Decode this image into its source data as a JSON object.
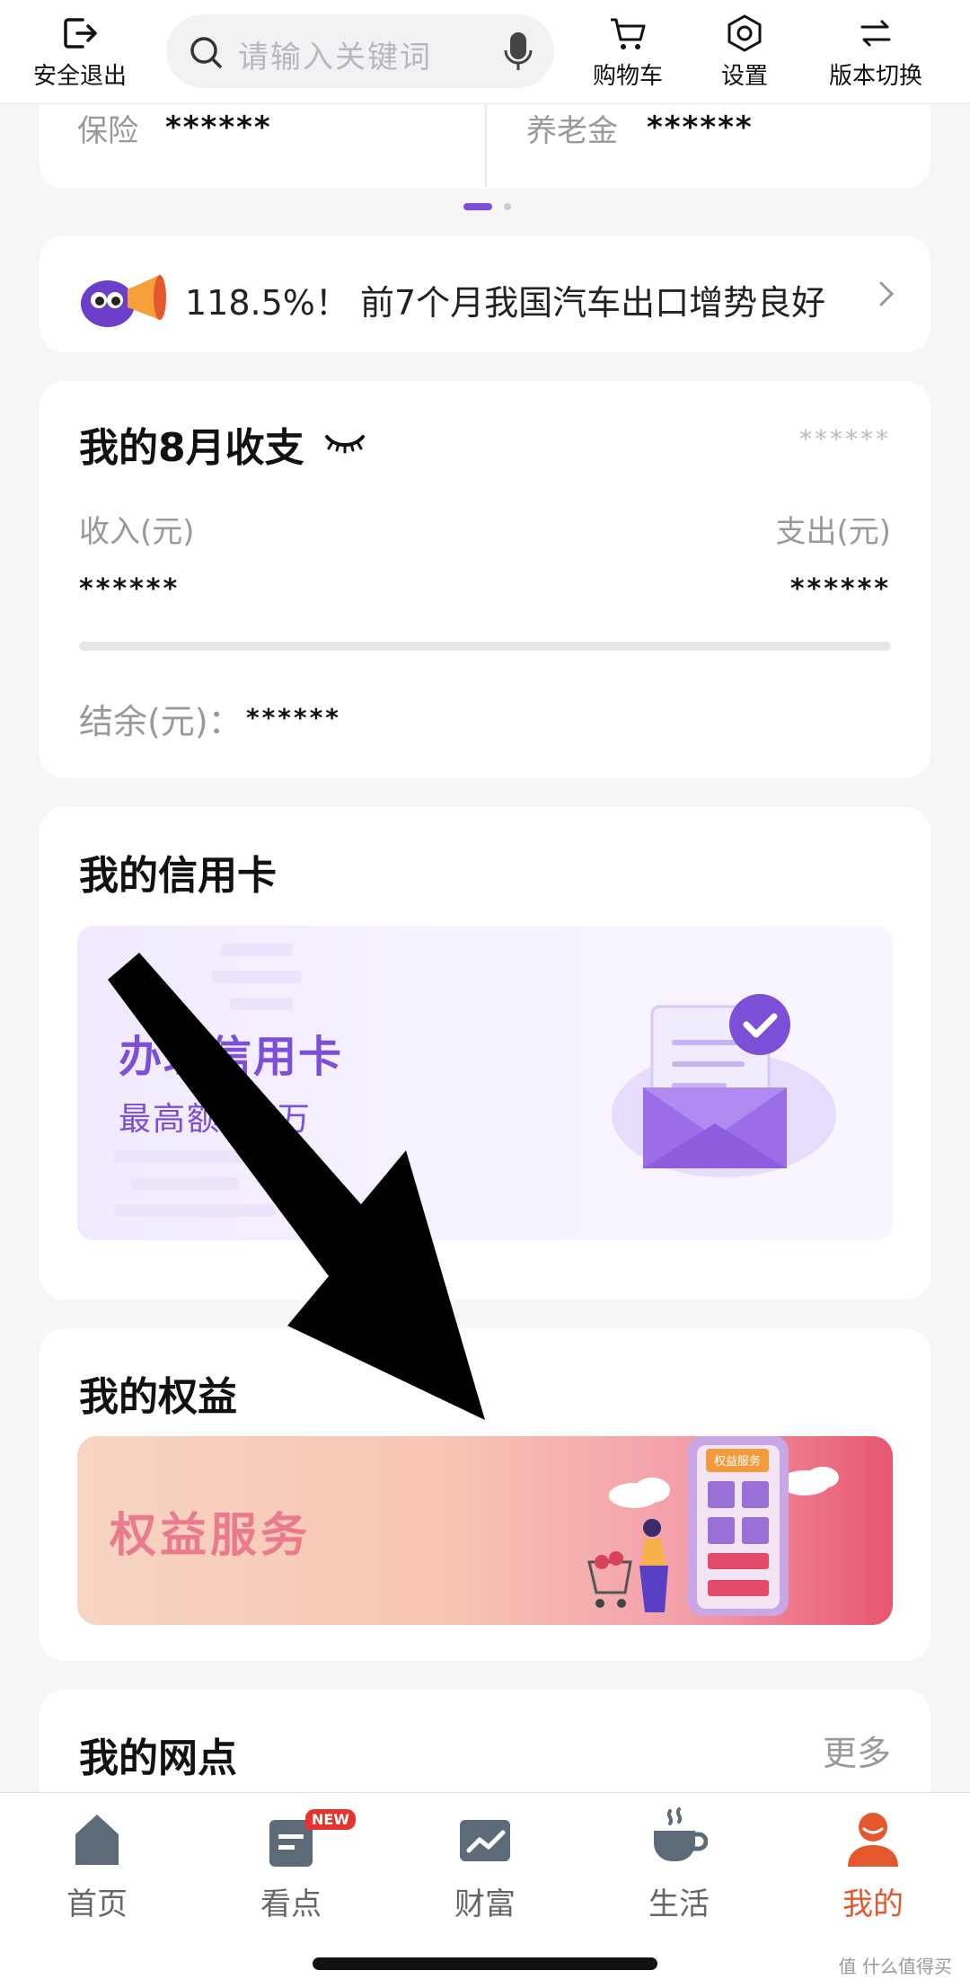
{
  "topbar": {
    "logout_label": "安全退出",
    "search_placeholder": "请输入关键词",
    "cart_label": "购物车",
    "settings_label": "设置",
    "version_label": "版本切换"
  },
  "assets_row": {
    "left_label": "保险",
    "left_value": "******",
    "right_label": "养老金",
    "right_value": "******"
  },
  "news": {
    "headline": "118.5%！ 前7个月我国汽车出口增势良好"
  },
  "income_card": {
    "title": "我的8月收支",
    "total_masked": "******",
    "income_label": "收入(元)",
    "income_value": "******",
    "expense_label": "支出(元)",
    "expense_value": "******",
    "balance_label": "结余(元)：",
    "balance_value": "******"
  },
  "credit_card": {
    "title": "我的信用卡",
    "banner_title": "办理信用卡",
    "banner_subtitle": "最高额度5万"
  },
  "rights": {
    "title": "我的权益",
    "banner_title": "权益服务",
    "art_sign": "权益服务"
  },
  "branch": {
    "title": "我的网点",
    "more_label": "更多"
  },
  "bottom_nav": {
    "items": [
      {
        "label": "首页"
      },
      {
        "label": "看点",
        "badge": "NEW"
      },
      {
        "label": "财富"
      },
      {
        "label": "生活"
      },
      {
        "label": "我的"
      }
    ],
    "active_color": "#e4582d"
  },
  "watermark": "值 什么值得买",
  "colors": {
    "accent_purple": "#7c4fd6",
    "accent_orange": "#e4582d"
  }
}
